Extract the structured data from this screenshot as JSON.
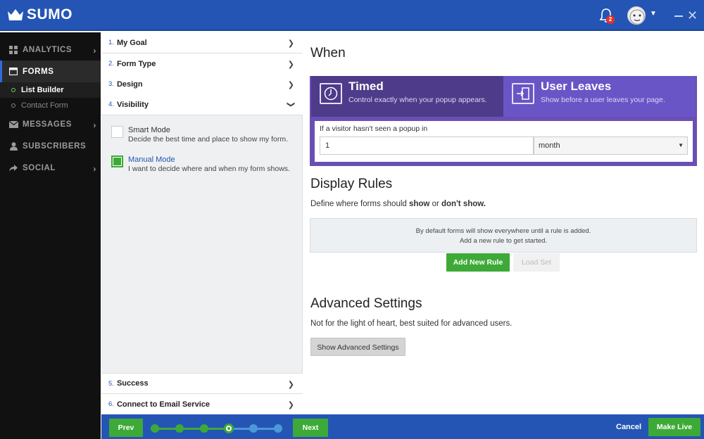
{
  "header": {
    "logo_text": "SUMO",
    "notification_count": "2"
  },
  "sidebar": {
    "items": [
      {
        "label": "ANALYTICS",
        "icon": "dashboard-icon"
      },
      {
        "label": "FORMS",
        "icon": "window-icon"
      },
      {
        "label": "MESSAGES",
        "icon": "envelope-icon"
      },
      {
        "label": "SUBSCRIBERS",
        "icon": "user-icon"
      },
      {
        "label": "SOCIAL",
        "icon": "share-icon"
      }
    ],
    "forms_sub": [
      {
        "label": "List Builder"
      },
      {
        "label": "Contact Form"
      }
    ]
  },
  "steps": {
    "items": [
      {
        "num": "1.",
        "label": "My Goal"
      },
      {
        "num": "2.",
        "label": "Form Type"
      },
      {
        "num": "3.",
        "label": "Design"
      },
      {
        "num": "4.",
        "label": "Visibility"
      },
      {
        "num": "5.",
        "label": "Success"
      },
      {
        "num": "6.",
        "label": "Connect to Email Service"
      }
    ],
    "options": [
      {
        "title": "Smart Mode",
        "desc": "Decide the best time and place to show my form.",
        "checked": false
      },
      {
        "title": "Manual Mode",
        "desc": "I want to decide where and when my form shows.",
        "checked": true
      }
    ]
  },
  "main": {
    "when_title": "When",
    "timed": {
      "title": "Timed",
      "desc": "Control exactly when your popup appears."
    },
    "leaves": {
      "title": "User Leaves",
      "desc": "Show before a user leaves your page."
    },
    "visitor_label": "If a visitor hasn't seen a popup in",
    "visitor_value": "1",
    "period_select": "month",
    "display_rules_title": "Display Rules",
    "display_rules_desc_prefix": "Define where forms should ",
    "display_rules_show": "show",
    "display_rules_or": " or ",
    "display_rules_dont": "don't show.",
    "rules_empty_line1": "By default forms will show everywhere until a rule is added.",
    "rules_empty_line2": "Add a new rule to get started.",
    "add_rule_button": "Add New Rule",
    "load_set_button": "Load Set",
    "advanced_title": "Advanced Settings",
    "advanced_desc": "Not for the light of heart, best suited for advanced users.",
    "advanced_button": "Show Advanced Settings"
  },
  "footer": {
    "prev_button": "Prev",
    "next_button": "Next",
    "cancel_button": "Cancel",
    "make_live_button": "Make Live",
    "progress_current_step": 4,
    "progress_total_steps": 6
  },
  "colors": {
    "brand_blue": "#2455b5",
    "accent_green": "#3daa37",
    "purple": "#6a55c7"
  }
}
